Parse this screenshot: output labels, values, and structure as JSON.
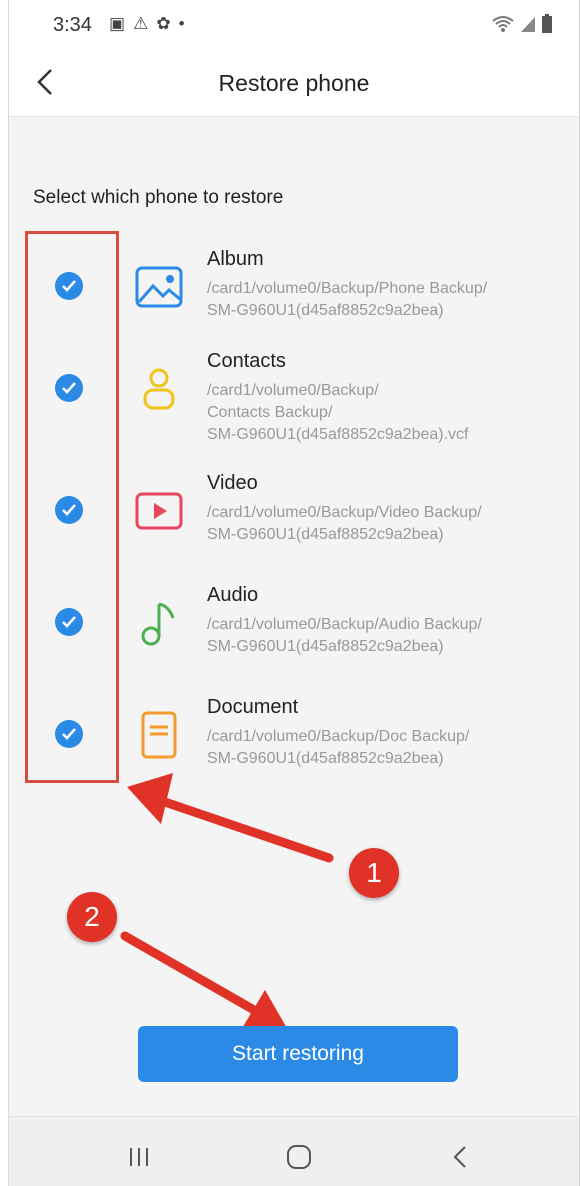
{
  "status_bar": {
    "time": "3:34",
    "dot": "•"
  },
  "header": {
    "title": "Restore phone"
  },
  "section_label": "Select which phone to restore",
  "items": [
    {
      "name": "Album",
      "path": "/card1/volume0/Backup/Phone Backup/\nSM-G960U1(d45af8852c9a2bea)",
      "icon": "album-icon",
      "color": "#2b8ae6",
      "checked": true
    },
    {
      "name": "Contacts",
      "path": "/card1/volume0/Backup/\nContacts Backup/\nSM-G960U1(d45af8852c9a2bea).vcf",
      "icon": "contact-icon",
      "color": "#f0c419",
      "checked": true
    },
    {
      "name": "Video",
      "path": "/card1/volume0/Backup/Video Backup/\nSM-G960U1(d45af8852c9a2bea)",
      "icon": "video-icon",
      "color": "#e8465a",
      "checked": true
    },
    {
      "name": "Audio",
      "path": "/card1/volume0/Backup/Audio Backup/\nSM-G960U1(d45af8852c9a2bea)",
      "icon": "music-note-icon",
      "color": "#4caf50",
      "checked": true
    },
    {
      "name": "Document",
      "path": "/card1/volume0/Backup/Doc Backup/\nSM-G960U1(d45af8852c9a2bea)",
      "icon": "document-icon",
      "color": "#f39c2b",
      "checked": true
    }
  ],
  "annotations": {
    "badge_1": "1",
    "badge_2": "2"
  },
  "start_button": "Start restoring",
  "colors": {
    "accent": "#2b8ae6",
    "annotation_red": "#e03226"
  }
}
